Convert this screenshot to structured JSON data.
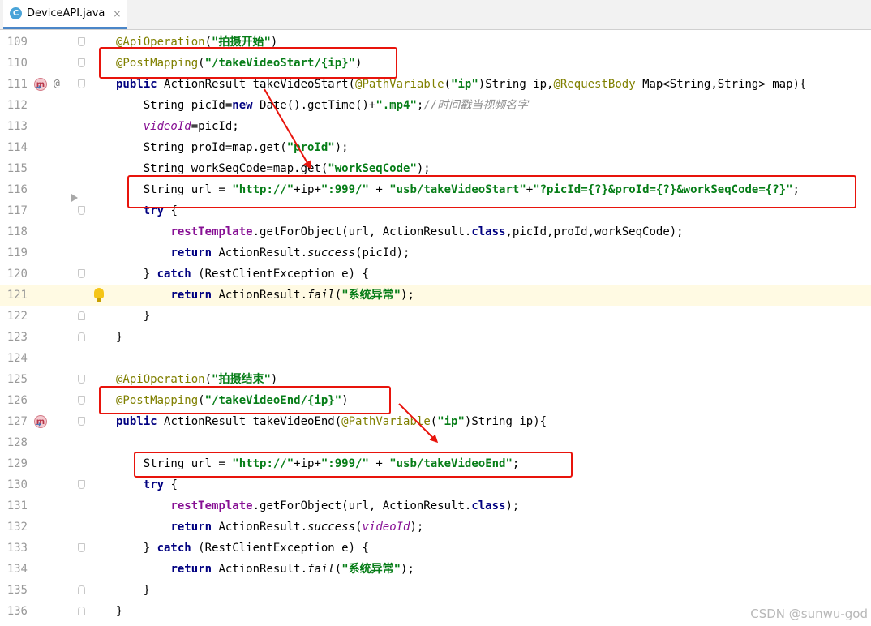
{
  "tab": {
    "icon_letter": "C",
    "file_name": "DeviceAPI.java",
    "close_glyph": "×"
  },
  "gutter_markers": {
    "method_letter": "m",
    "override_glyph": "@"
  },
  "lines": [
    {
      "num": "109",
      "tokens": [
        [
          "ann",
          "@ApiOperation"
        ],
        [
          "",
          "("
        ],
        [
          "str",
          "\"拍摄开始\""
        ],
        [
          "",
          ")"
        ]
      ]
    },
    {
      "num": "110",
      "tokens": [
        [
          "ann",
          "@PostMapping"
        ],
        [
          "",
          "("
        ],
        [
          "str",
          "\"/takeVideoStart/{ip}\""
        ],
        [
          "",
          ")"
        ]
      ]
    },
    {
      "num": "111",
      "tokens": [
        [
          "kw",
          "public "
        ],
        [
          "",
          "ActionResult takeVideoStart("
        ],
        [
          "ann",
          "@PathVariable"
        ],
        [
          "",
          "("
        ],
        [
          "str",
          "\"ip\""
        ],
        [
          "",
          ")String ip,"
        ],
        [
          "ann",
          "@RequestBody"
        ],
        [
          "",
          " Map<String,String> map){"
        ]
      ]
    },
    {
      "num": "112",
      "tokens": [
        [
          "",
          "    String picId="
        ],
        [
          "kw",
          "new "
        ],
        [
          "",
          "Date().getTime()+"
        ],
        [
          "str",
          "\".mp4\""
        ],
        [
          "",
          ";"
        ],
        [
          "com",
          "//时间戳当视频名字"
        ]
      ]
    },
    {
      "num": "113",
      "tokens": [
        [
          "",
          "    "
        ],
        [
          "fld",
          "videoId"
        ],
        [
          "",
          "=picId;"
        ]
      ]
    },
    {
      "num": "114",
      "tokens": [
        [
          "",
          "    String proId=map.get("
        ],
        [
          "str",
          "\"proId\""
        ],
        [
          "",
          ");"
        ]
      ]
    },
    {
      "num": "115",
      "tokens": [
        [
          "",
          "    String workSeqCode=map.get("
        ],
        [
          "str",
          "\"workSeqCode\""
        ],
        [
          "",
          ");"
        ]
      ]
    },
    {
      "num": "116",
      "tokens": [
        [
          "",
          "    String url = "
        ],
        [
          "str",
          "\"http://\""
        ],
        [
          "",
          "+ip+"
        ],
        [
          "str",
          "\":999/\""
        ],
        [
          "",
          " + "
        ],
        [
          "str",
          "\"usb/takeVideoStart\""
        ],
        [
          "",
          "+"
        ],
        [
          "str",
          "\"?picId={?}&proId={?}&workSeqCode={?}\""
        ],
        [
          "",
          ";"
        ]
      ]
    },
    {
      "num": "117",
      "tokens": [
        [
          "",
          "    "
        ],
        [
          "kw",
          "try "
        ],
        [
          "",
          "{"
        ]
      ]
    },
    {
      "num": "118",
      "tokens": [
        [
          "",
          "        "
        ],
        [
          "fldb",
          "restTemplate"
        ],
        [
          "",
          ".getForObject(url, ActionResult."
        ],
        [
          "kw",
          "class"
        ],
        [
          "",
          ",picId,proId,workSeqCode);"
        ]
      ]
    },
    {
      "num": "119",
      "tokens": [
        [
          "",
          "        "
        ],
        [
          "kw",
          "return "
        ],
        [
          "",
          "ActionResult."
        ],
        [
          "st",
          "success"
        ],
        [
          "",
          "(picId);"
        ]
      ]
    },
    {
      "num": "120",
      "tokens": [
        [
          "",
          "    } "
        ],
        [
          "kw",
          "catch "
        ],
        [
          "",
          "(RestClientException e) {"
        ]
      ]
    },
    {
      "num": "121",
      "tokens": [
        [
          "",
          "        "
        ],
        [
          "kw",
          "return "
        ],
        [
          "",
          "ActionResult."
        ],
        [
          "st",
          "fail"
        ],
        [
          "",
          "("
        ],
        [
          "str",
          "\"系统异常\""
        ],
        [
          "",
          ");"
        ]
      ]
    },
    {
      "num": "122",
      "tokens": [
        [
          "",
          "    }"
        ]
      ]
    },
    {
      "num": "123",
      "tokens": [
        [
          "",
          "}"
        ]
      ]
    },
    {
      "num": "124",
      "tokens": []
    },
    {
      "num": "125",
      "tokens": [
        [
          "ann",
          "@ApiOperation"
        ],
        [
          "",
          "("
        ],
        [
          "str",
          "\"拍摄结束\""
        ],
        [
          "",
          ")"
        ]
      ]
    },
    {
      "num": "126",
      "tokens": [
        [
          "ann",
          "@PostMapping"
        ],
        [
          "",
          "("
        ],
        [
          "str",
          "\"/takeVideoEnd/{ip}\""
        ],
        [
          "",
          ")"
        ]
      ]
    },
    {
      "num": "127",
      "tokens": [
        [
          "kw",
          "public "
        ],
        [
          "",
          "ActionResult takeVideoEnd("
        ],
        [
          "ann",
          "@PathVariable"
        ],
        [
          "",
          "("
        ],
        [
          "str",
          "\"ip\""
        ],
        [
          "",
          ")String ip){"
        ]
      ]
    },
    {
      "num": "128",
      "tokens": []
    },
    {
      "num": "129",
      "tokens": [
        [
          "",
          "    String url = "
        ],
        [
          "str",
          "\"http://\""
        ],
        [
          "",
          "+ip+"
        ],
        [
          "str",
          "\":999/\""
        ],
        [
          "",
          " + "
        ],
        [
          "str",
          "\"usb/takeVideoEnd\""
        ],
        [
          "",
          ";"
        ]
      ]
    },
    {
      "num": "130",
      "tokens": [
        [
          "",
          "    "
        ],
        [
          "kw",
          "try "
        ],
        [
          "",
          "{"
        ]
      ]
    },
    {
      "num": "131",
      "tokens": [
        [
          "",
          "        "
        ],
        [
          "fldb",
          "restTemplate"
        ],
        [
          "",
          ".getForObject(url, ActionResult."
        ],
        [
          "kw",
          "class"
        ],
        [
          "",
          ");"
        ]
      ]
    },
    {
      "num": "132",
      "tokens": [
        [
          "",
          "        "
        ],
        [
          "kw",
          "return "
        ],
        [
          "",
          "ActionResult."
        ],
        [
          "st",
          "success"
        ],
        [
          "",
          "("
        ],
        [
          "fld",
          "videoId"
        ],
        [
          "",
          ");"
        ]
      ]
    },
    {
      "num": "133",
      "tokens": [
        [
          "",
          "    } "
        ],
        [
          "kw",
          "catch "
        ],
        [
          "",
          "(RestClientException e) {"
        ]
      ]
    },
    {
      "num": "134",
      "tokens": [
        [
          "",
          "        "
        ],
        [
          "kw",
          "return "
        ],
        [
          "",
          "ActionResult."
        ],
        [
          "st",
          "fail"
        ],
        [
          "",
          "("
        ],
        [
          "str",
          "\"系统异常\""
        ],
        [
          "",
          ");"
        ]
      ]
    },
    {
      "num": "135",
      "tokens": [
        [
          "",
          "    }"
        ]
      ]
    },
    {
      "num": "136",
      "tokens": [
        [
          "",
          "}"
        ]
      ]
    }
  ],
  "watermark": "CSDN @sunwu-god",
  "colors": {
    "annotation_box": "#e8140c",
    "current_line": "#fffae3",
    "keyword": "#000080",
    "string": "#067d17",
    "annotation": "#808000",
    "comment": "#8c8c8c",
    "field": "#871094"
  }
}
